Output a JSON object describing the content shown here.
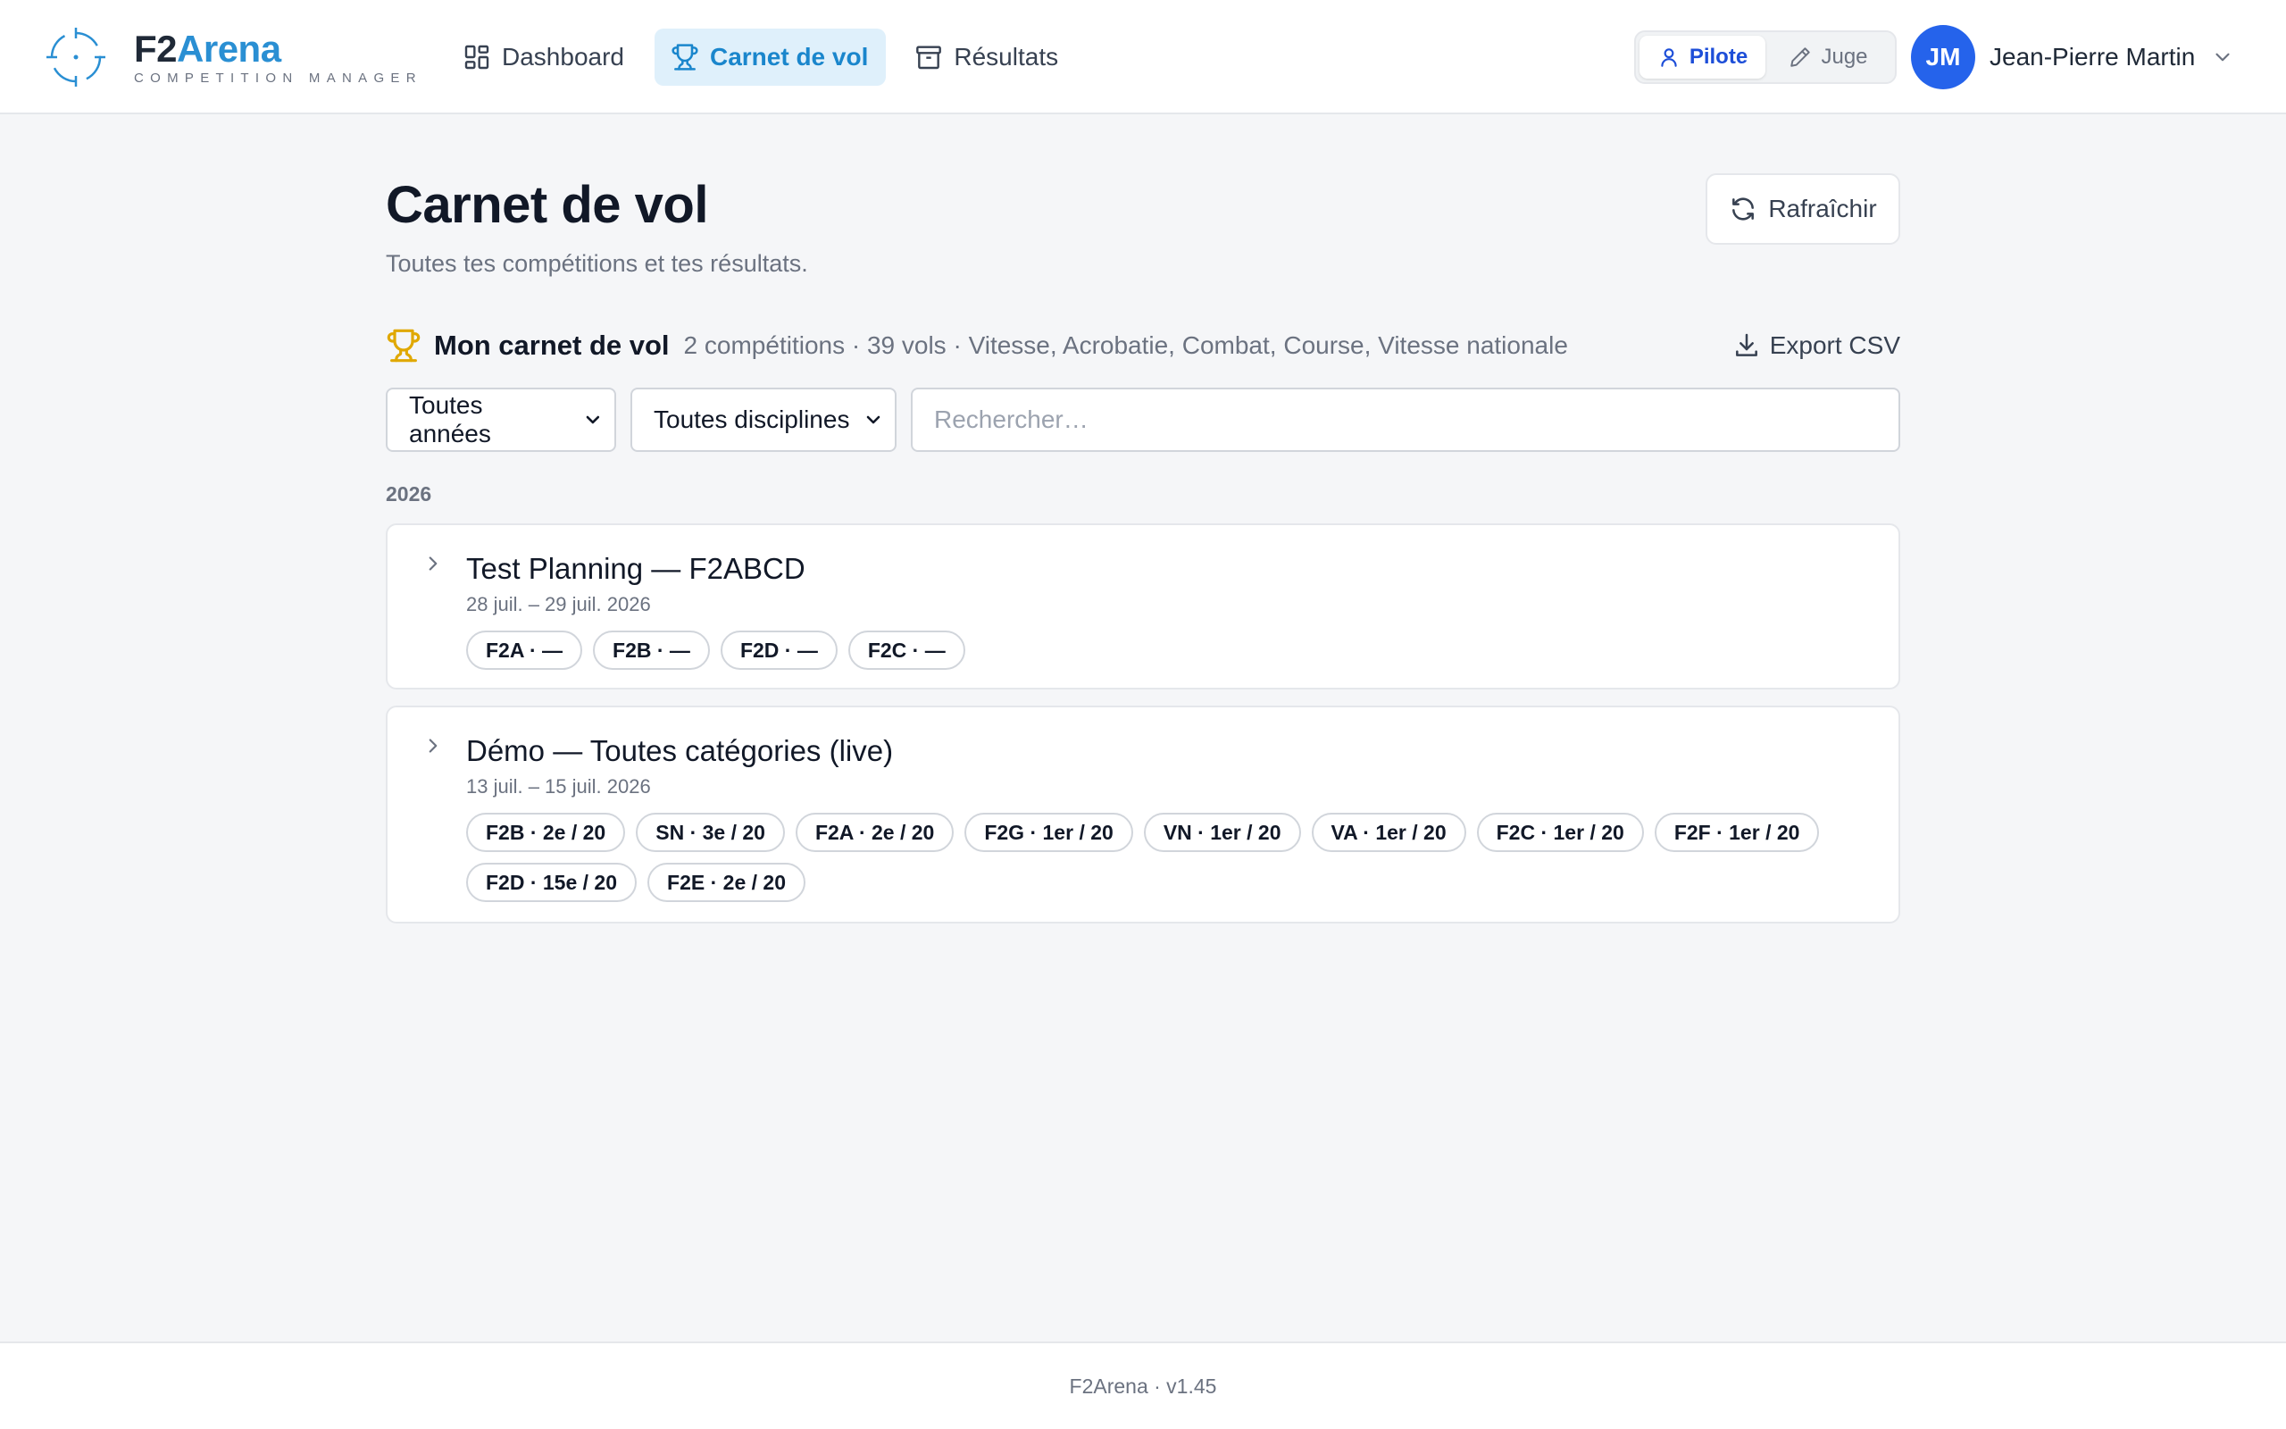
{
  "header": {
    "brand_primary": "F2",
    "brand_accent": "Arena",
    "brand_tagline": "COMPETITION MANAGER",
    "brand_color": "#2a8fd3",
    "nav": [
      {
        "label": "Dashboard",
        "icon": "dashboard-grid-icon",
        "active": false
      },
      {
        "label": "Carnet de vol",
        "icon": "trophy-icon",
        "active": true
      },
      {
        "label": "Résultats",
        "icon": "archive-box-icon",
        "active": false
      }
    ],
    "roles": [
      {
        "label": "Pilote",
        "icon": "user-icon",
        "active": true
      },
      {
        "label": "Juge",
        "icon": "pencil-icon",
        "active": false
      }
    ],
    "user": {
      "initials": "JM",
      "name": "Jean-Pierre Martin",
      "avatar_color": "#2563eb"
    }
  },
  "main": {
    "title": "Carnet de vol",
    "subtitle": "Toutes tes compétitions et tes résultats.",
    "refresh_label": "Rafraîchir",
    "carnet": {
      "title": "Mon carnet de vol",
      "meta": "2 compétitions · 39 vols · Vitesse, Acrobatie, Combat, Course, Vitesse nationale",
      "export_label": "Export CSV"
    },
    "filters": {
      "year_selected": "Toutes années",
      "discipline_selected": "Toutes disciplines",
      "search_placeholder": "Rechercher…",
      "search_value": ""
    },
    "year_group": "2026",
    "competitions": [
      {
        "name": "Test Planning — F2ABCD",
        "dates": "28 juil. – 29 juil. 2026",
        "chips": [
          "F2A · —",
          "F2B · —",
          "F2D · —",
          "F2C · —"
        ]
      },
      {
        "name": "Démo — Toutes catégories (live)",
        "dates": "13 juil. – 15 juil. 2026",
        "chips": [
          "F2B · 2e / 20",
          "SN · 3e / 20",
          "F2A · 2e / 20",
          "F2G · 1er / 20",
          "VN · 1er / 20",
          "VA · 1er / 20",
          "F2C · 1er / 20",
          "F2F · 1er / 20",
          "F2D · 15e / 20",
          "F2E · 2e / 20"
        ]
      }
    ]
  },
  "footer": {
    "text": "F2Arena · v1.45"
  }
}
